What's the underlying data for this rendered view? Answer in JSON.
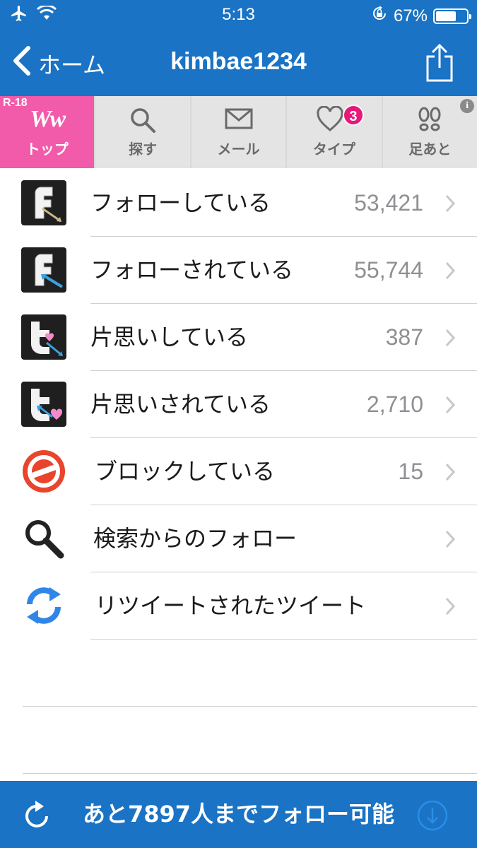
{
  "status_bar": {
    "time": "5:13",
    "battery": "67%"
  },
  "nav": {
    "back_label": "ホーム",
    "title": "kimbae1234"
  },
  "tabs": [
    {
      "badge_text": "R-18",
      "logo_text": "Ww",
      "label": "トップ"
    },
    {
      "label": "探す"
    },
    {
      "label": "メール"
    },
    {
      "label": "タイプ",
      "badge": "3"
    },
    {
      "label": "足あと"
    }
  ],
  "ad_info": "i",
  "rows": [
    {
      "label": "フォローしている",
      "count": "53,421",
      "icon": "follow-icon"
    },
    {
      "label": "フォローされている",
      "count": "55,744",
      "icon": "follower-icon"
    },
    {
      "label": "片思いしている",
      "count": "387",
      "icon": "one-way-following-icon"
    },
    {
      "label": "片思いされている",
      "count": "2,710",
      "icon": "one-way-follower-icon"
    },
    {
      "label": "ブロックしている",
      "count": "15",
      "icon": "block-icon"
    },
    {
      "label": "検索からのフォロー",
      "count": "",
      "icon": "search-icon"
    },
    {
      "label": "リツイートされたツイート",
      "count": "",
      "icon": "retweet-icon"
    }
  ],
  "bottom_bar": {
    "text": "あと7897人までフォロー可能"
  },
  "colors": {
    "header_blue": "#1a73c4",
    "pink_tab": "#f25aaa",
    "badge_pink": "#e8177a"
  }
}
